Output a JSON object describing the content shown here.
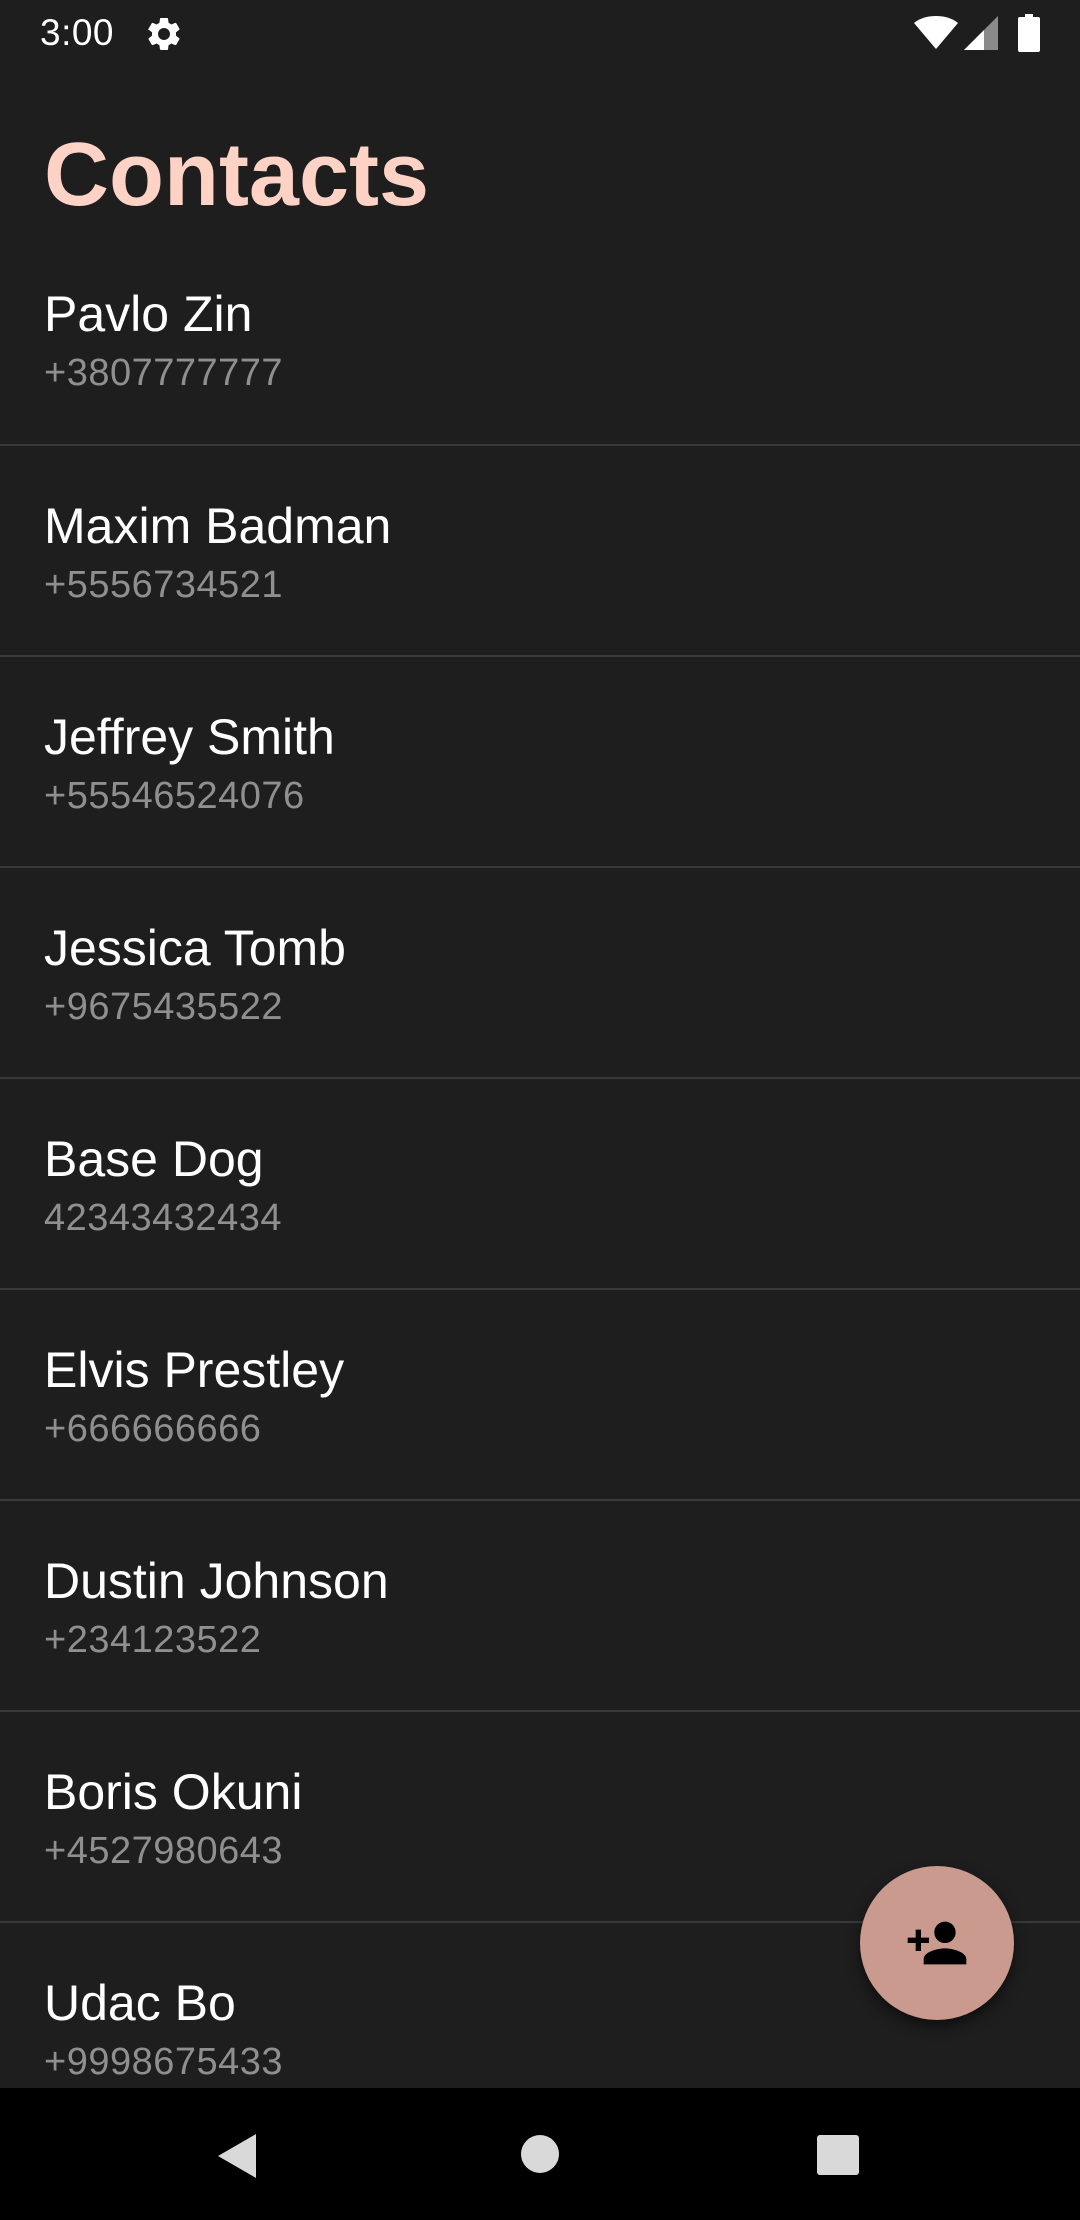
{
  "status_bar": {
    "time": "3:00",
    "icons": [
      "gear-icon",
      "wifi-icon",
      "signal-icon",
      "battery-icon"
    ]
  },
  "header": {
    "title": "Contacts"
  },
  "contacts": [
    {
      "name": "Pavlo Zin",
      "phone": "+3807777777"
    },
    {
      "name": "Maxim Badman",
      "phone": "+5556734521"
    },
    {
      "name": "Jeffrey Smith",
      "phone": "+55546524076"
    },
    {
      "name": "Jessica Tomb",
      "phone": "+9675435522"
    },
    {
      "name": "Base Dog",
      "phone": "42343432434"
    },
    {
      "name": "Elvis Prestley",
      "phone": "+666666666"
    },
    {
      "name": "Dustin Johnson",
      "phone": "+234123522"
    },
    {
      "name": "Boris Okuni",
      "phone": "+4527980643"
    },
    {
      "name": "Udac Bo",
      "phone": "+9998675433"
    }
  ],
  "fab": {
    "icon": "add-person-icon"
  },
  "nav_bar": {
    "icons": [
      "back-icon",
      "home-icon",
      "recents-icon"
    ]
  },
  "colors": {
    "background": "#1e1e1f",
    "title": "#ffd2c6",
    "fab": "#c99a8d",
    "divider": "#3a3a3b",
    "secondary_text": "#8f8f90"
  }
}
